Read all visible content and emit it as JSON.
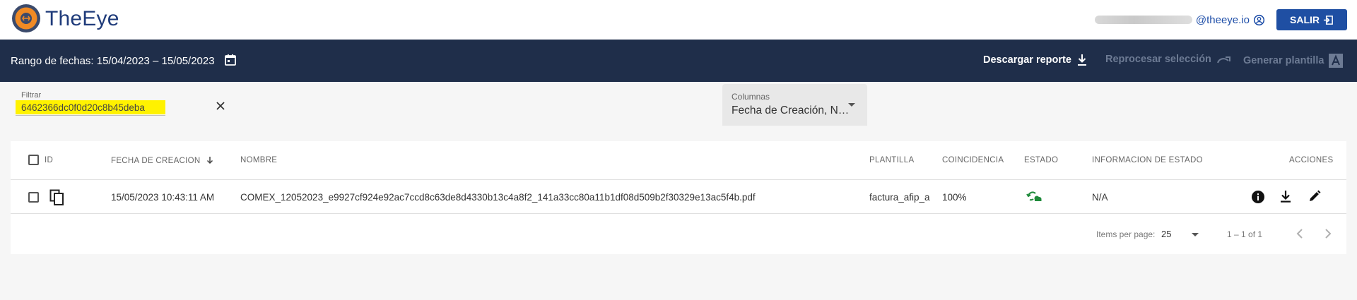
{
  "header": {
    "brand": "TheEye",
    "user_email_domain": "@theeye.io",
    "logout_label": "SALIR"
  },
  "navbar": {
    "date_range": "Rango de fechas: 15/04/2023 – 15/05/2023",
    "actions": {
      "download": "Descargar reporte",
      "reprocess": "Reprocesar selección",
      "generate": "Generar plantilla"
    }
  },
  "filter": {
    "label": "Filtrar",
    "value": "6462366dc0f0d20c8b45deba"
  },
  "columns": {
    "label": "Columnas",
    "value": "Fecha de Creación, N…"
  },
  "table": {
    "headers": {
      "id": "ID",
      "fecha": "FECHA DE CREACION",
      "nombre": "NOMBRE",
      "plantilla": "PLANTILLA",
      "coincidencia": "COINCIDENCIA",
      "estado": "ESTADO",
      "informacion": "INFORMACION DE ESTADO",
      "acciones": "ACCIONES"
    },
    "rows": [
      {
        "fecha": "15/05/2023 10:43:11 AM",
        "nombre": "COMEX_12052023_e9927cf924e92ac7ccd8c63de8d4330b13c4a8f2_141a33cc80a11b1df08d509b2f30329e13ac5f4b.pdf",
        "plantilla": "factura_afip_a",
        "coincidencia": "100%",
        "informacion": "N/A"
      }
    ]
  },
  "paginator": {
    "items_label": "Items per page:",
    "page_size": "25",
    "range": "1 – 1 of 1"
  },
  "colors": {
    "navbar": "#1f2e4a",
    "brand": "#1f3b7a",
    "button": "#1f4fa3",
    "highlight": "#fff200",
    "status_green": "#1e8a3a"
  }
}
